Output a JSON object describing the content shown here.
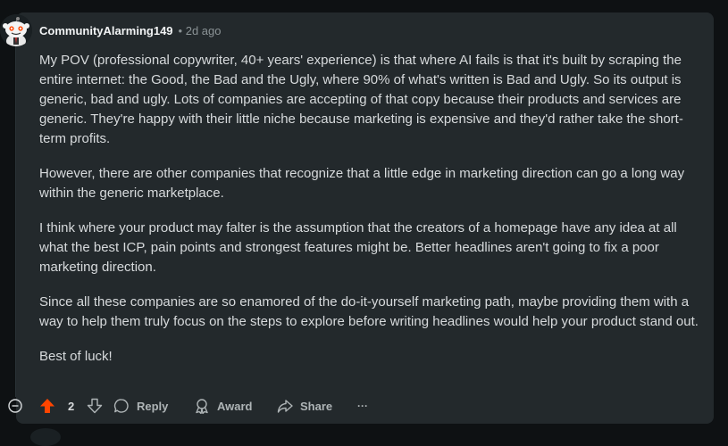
{
  "comment": {
    "username": "CommunityAlarming149",
    "time": "• 2d ago",
    "paragraphs": [
      "My POV (professional copywriter, 40+ years' experience) is that where AI fails is that it's built by scraping the entire internet: the Good, the Bad and the Ugly, where 90% of what's written is Bad and Ugly. So its output is generic, bad and ugly. Lots of companies are accepting of that copy because their products and services are generic. They're happy with their little niche because marketing is expensive and they'd rather take the short-term profits.",
      "However, there are other companies that recognize that a little edge in marketing direction can go a long way within the generic marketplace.",
      "I think where your product may falter is the assumption that the creators of a homepage have any idea at all what the best ICP, pain points and strongest features might be. Better headlines aren't going to fix a poor marketing direction.",
      "Since all these companies are so enamored of the do-it-yourself marketing path, maybe providing them with a way to help them truly focus on the steps to explore before writing headlines would help your product stand out.",
      "Best of luck!"
    ]
  },
  "actions": {
    "vote_count": "2",
    "reply_label": "Reply",
    "award_label": "Award",
    "share_label": "Share",
    "more_label": "···"
  },
  "colors": {
    "upvote_active": "#ff4500",
    "card_bg": "#23292c",
    "page_bg": "#0e1113"
  }
}
